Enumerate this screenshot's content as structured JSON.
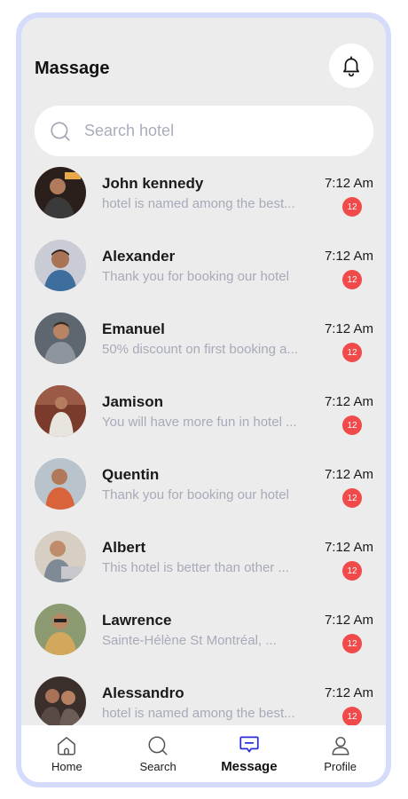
{
  "header": {
    "title": "Massage",
    "bell_icon": "bell-icon"
  },
  "search": {
    "placeholder": "Search hotel",
    "icon": "search-icon"
  },
  "messages": [
    {
      "name": "John kennedy",
      "preview": "hotel is named among the best...",
      "time": "7:12 Am",
      "badge": "12"
    },
    {
      "name": "Alexander",
      "preview": "Thank you for booking our hotel",
      "time": "7:12 Am",
      "badge": "12"
    },
    {
      "name": "Emanuel",
      "preview": "50% discount on first booking a...",
      "time": "7:12 Am",
      "badge": "12"
    },
    {
      "name": "Jamison",
      "preview": "You will have more fun in  hotel ...",
      "time": "7:12 Am",
      "badge": "12"
    },
    {
      "name": "Quentin",
      "preview": "Thank you for booking our hotel",
      "time": "7:12 Am",
      "badge": "12"
    },
    {
      "name": "Albert",
      "preview": "This hotel is better than other ...",
      "time": "7:12 Am",
      "badge": "12"
    },
    {
      "name": "Lawrence",
      "preview": " Sainte-Hélène St Montréal, ...",
      "time": "7:12 Am",
      "badge": "12"
    },
    {
      "name": "Alessandro",
      "preview": "hotel is named among the best...",
      "time": "7:12 Am",
      "badge": "12"
    }
  ],
  "nav": {
    "home": "Home",
    "search": "Search",
    "message": "Message",
    "profile": "Profile",
    "active": "message"
  },
  "colors": {
    "accent": "#2a2ed6",
    "badge": "#f04a4a",
    "frame": "#d5dbfa",
    "background": "#ececec"
  }
}
